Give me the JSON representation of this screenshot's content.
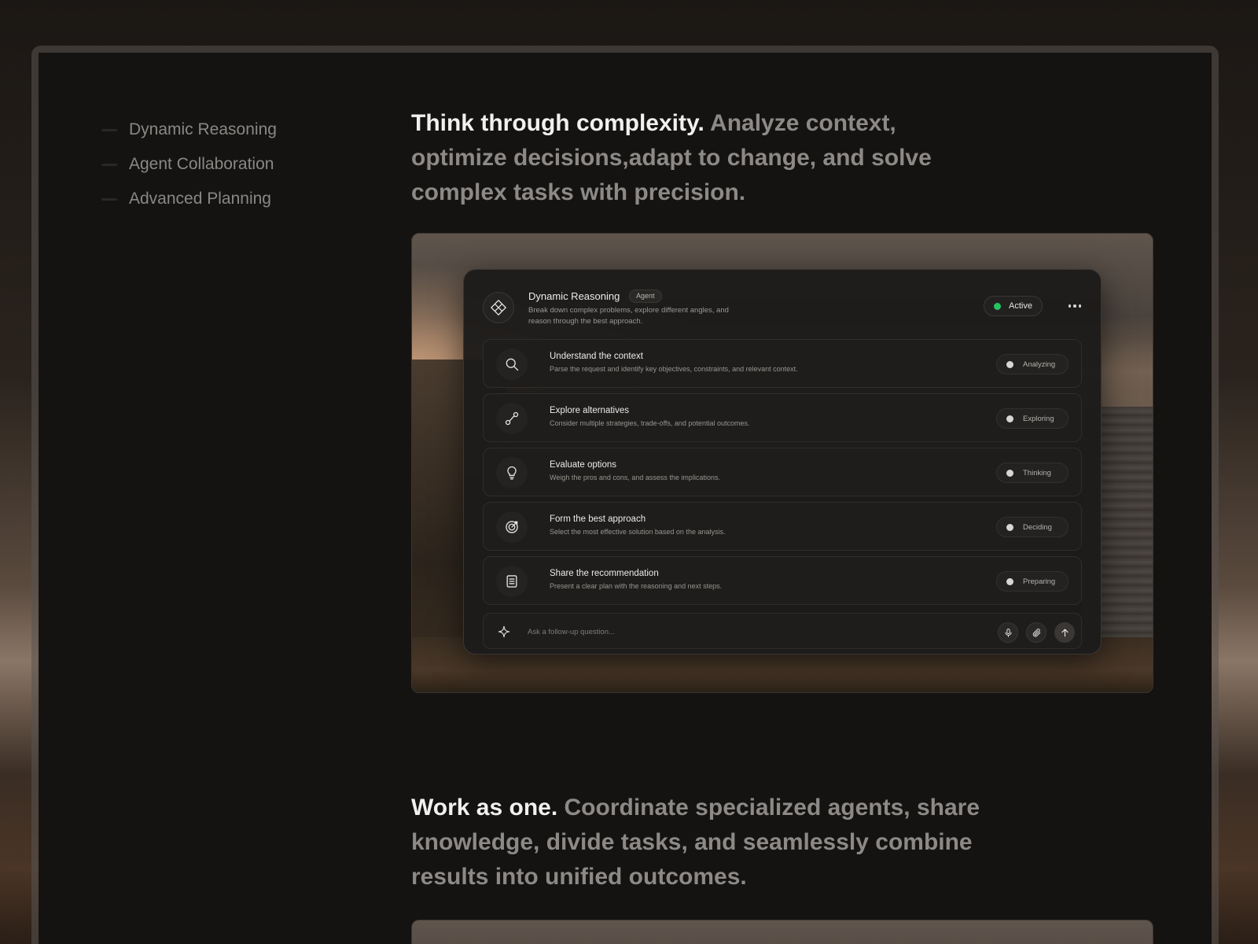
{
  "sidebar": {
    "items": [
      {
        "label": "Dynamic Reasoning"
      },
      {
        "label": "Agent Collaboration"
      },
      {
        "label": "Advanced Planning"
      }
    ]
  },
  "sections": [
    {
      "lead": "Think through complexity.",
      "body": "Analyze context, optimize decisions,adapt to change, and solve complex tasks with precision."
    },
    {
      "lead": "Work as one.",
      "body": "Coordinate specialized agents, share knowledge, divide tasks, and seamlessly combine results into unified outcomes."
    }
  ],
  "agent": {
    "title": "Dynamic Reasoning",
    "badge": "Agent",
    "description": "Break down complex problems, explore different angles, and reason through the best approach.",
    "status_label": "Active",
    "status_color": "#22c55e",
    "steps": [
      {
        "icon": "search-icon",
        "title": "Understand the context",
        "desc": "Parse the request and identify key objectives, constraints, and relevant context.",
        "status": "Analyzing"
      },
      {
        "icon": "branch-icon",
        "title": "Explore alternatives",
        "desc": "Consider multiple strategies, trade-offs, and potential outcomes.",
        "status": "Exploring"
      },
      {
        "icon": "lightbulb-icon",
        "title": "Evaluate options",
        "desc": "Weigh the pros and cons, and assess the implications.",
        "status": "Thinking"
      },
      {
        "icon": "target-icon",
        "title": "Form the best approach",
        "desc": "Select the most effective solution based on the analysis.",
        "status": "Deciding"
      },
      {
        "icon": "document-icon",
        "title": "Share the recommendation",
        "desc": "Present a clear plan with the reasoning and next steps.",
        "status": "Preparing"
      }
    ],
    "composer": {
      "placeholder": "Ask a follow-up question..."
    }
  }
}
